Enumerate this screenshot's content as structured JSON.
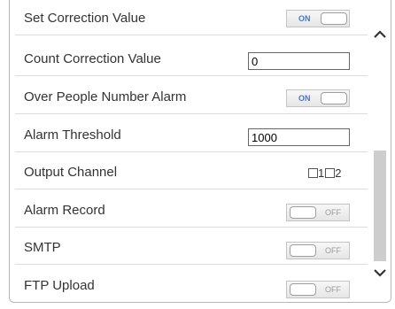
{
  "rows": [
    {
      "label": "Set Correction Value",
      "type": "toggle",
      "state": "ON"
    },
    {
      "label": "Count Correction Value",
      "type": "text",
      "value": "0"
    },
    {
      "label": "Over People Number Alarm",
      "type": "toggle",
      "state": "ON"
    },
    {
      "label": "Alarm Threshold",
      "type": "text",
      "value": "1000"
    },
    {
      "label": "Output Channel",
      "type": "checkboxes",
      "options": [
        "1",
        "2"
      ]
    },
    {
      "label": "Alarm Record",
      "type": "toggle",
      "state": "OFF"
    },
    {
      "label": "SMTP",
      "type": "toggle",
      "state": "OFF"
    },
    {
      "label": "FTP Upload",
      "type": "toggle",
      "state": "OFF"
    }
  ],
  "scrollbar": {
    "up_icon": "chevron-up-icon",
    "down_icon": "chevron-down-icon"
  }
}
